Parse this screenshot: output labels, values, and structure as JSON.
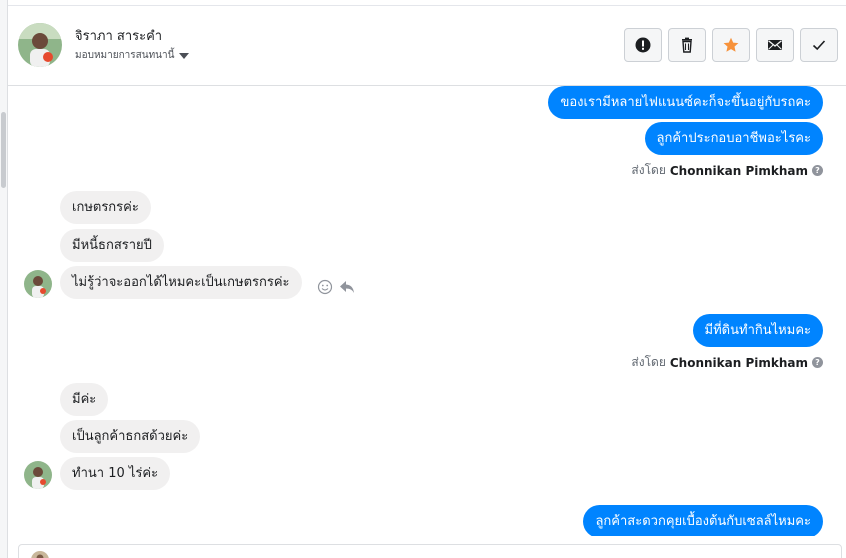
{
  "header": {
    "contact_name": "จิราภา สาระคำ",
    "assign_label": "มอบหมายการสนทนานี้",
    "actions": [
      {
        "name": "spam-button",
        "icon": "exclamation-icon"
      },
      {
        "name": "delete-button",
        "icon": "trash-icon"
      },
      {
        "name": "star-button",
        "icon": "star-icon"
      },
      {
        "name": "mark-unread-button",
        "icon": "envelope-icon"
      },
      {
        "name": "mark-done-button",
        "icon": "checkmark-icon"
      }
    ]
  },
  "colors": {
    "outgoing_bubble": "#0084ff",
    "incoming_bubble": "#f1f0f0",
    "star": "#f7923b"
  },
  "thread": {
    "messages": [
      {
        "direction": "out",
        "text": "ของเรามีหลายไฟแนนซ์คะก็จะขึ้นอยู่กับรถคะ"
      },
      {
        "direction": "out",
        "text": "ลูกค้าประกอบอาชีพอะไรคะ"
      },
      {
        "direction": "in",
        "text": "เกษตรกรค่ะ"
      },
      {
        "direction": "in",
        "text": "มีหนี้ธกสรายปี"
      },
      {
        "direction": "in",
        "text": "ไม่รู้ว่าจะออกได้ไหมคะเป็นเกษตรกรค่ะ"
      },
      {
        "direction": "out",
        "text": "มีที่ดินทำกินไหมคะ"
      },
      {
        "direction": "in",
        "text": "มีค่ะ"
      },
      {
        "direction": "in",
        "text": "เป็นลูกค้าธกสด้วยค่ะ"
      },
      {
        "direction": "in",
        "text": "ทำนา 10 ไร่ค่ะ"
      },
      {
        "direction": "out",
        "text": "ลูกค้าสะดวกคุยเบื้องต้นกับเซลล์ไหมคะ"
      }
    ],
    "sent_by": [
      {
        "prefix": "ส่งโดย",
        "name": "Chonnikan Pimkham"
      },
      {
        "prefix": "ส่งโดย",
        "name": "Chonnikan Pimkham"
      }
    ]
  }
}
